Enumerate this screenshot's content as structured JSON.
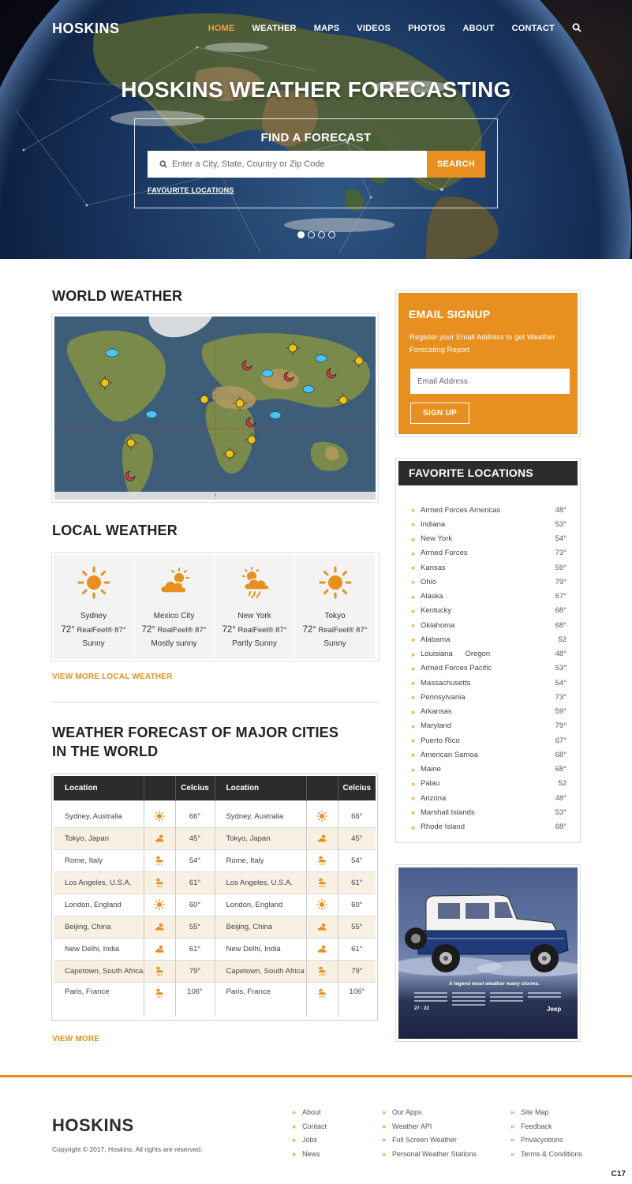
{
  "header": {
    "brand": "HOSKINS",
    "nav": [
      "HOME",
      "WEATHER",
      "MAPS",
      "VIDEOS",
      "PHOTOS",
      "ABOUT",
      "CONTACT"
    ],
    "active_nav": "HOME",
    "title": "HOSKINS WEATHER FORECASTING",
    "search": {
      "heading": "FIND A FORECAST",
      "placeholder": "Enter a City, State, Country or Zip Code",
      "button": "SEARCH",
      "favourites_link": "FAVOURITE LOCATIONS"
    },
    "slider": {
      "count": 4,
      "active": 1
    }
  },
  "world_weather": {
    "title": "WORLD WEATHER"
  },
  "local_weather": {
    "title": "LOCAL WEATHER",
    "cards": [
      {
        "city": "Sydney",
        "temp": "72°",
        "realfeel": "RealFeel® 87°",
        "condition": "Sunny",
        "icon": "sun-icon"
      },
      {
        "city": "Mexico City",
        "temp": "72°",
        "realfeel": "RealFeel® 87°",
        "condition": "Mostly sunny",
        "icon": "cloud-sun-icon"
      },
      {
        "city": "New York",
        "temp": "72°",
        "realfeel": "RealFeel® 87°",
        "condition": "Partly Sunny",
        "icon": "rain-sun-icon"
      },
      {
        "city": "Tokyo",
        "temp": "72°",
        "realfeel": "RealFeel® 87°",
        "condition": "Sunny",
        "icon": "sun-icon"
      }
    ],
    "more_link": "VIEW MORE LOCAL WEATHER"
  },
  "forecast": {
    "title_line1": "WEATHER FORECAST OF MAJOR CITIES",
    "title_line2": "IN THE WORLD",
    "headers": {
      "location": "Location",
      "celcius": "Celcius"
    },
    "rows": [
      {
        "location": "Sydney, Australia",
        "temp": "66°",
        "icon": "sun-icon"
      },
      {
        "location": "Tokyo, Japan",
        "temp": "45°",
        "icon": "cloud-sun-icon"
      },
      {
        "location": "Rome, Italy",
        "temp": "54°",
        "icon": "rain-sun-icon"
      },
      {
        "location": "Los Angeles, U.S.A.",
        "temp": "61°",
        "icon": "rain-sun-icon"
      },
      {
        "location": "London, England",
        "temp": "60°",
        "icon": "sun-icon"
      },
      {
        "location": "Beijing, China",
        "temp": "55°",
        "icon": "cloud-sun-icon"
      },
      {
        "location": "New Delhi, India",
        "temp": "61°",
        "icon": "cloud-sun-icon"
      },
      {
        "location": "Capetown, South Africa",
        "temp": "79°",
        "icon": "rain-sun-icon"
      },
      {
        "location": "Paris, France",
        "temp": "106°",
        "icon": "rain-sun-icon"
      }
    ],
    "more_link": "VIEW MORE"
  },
  "email_signup": {
    "title": "EMAIL SIGNUP",
    "description": "Register your Email Address to get Weather Forecating Report",
    "placeholder": "Email Address",
    "button": "SIGN UP"
  },
  "favorite_locations": {
    "title": "FAVORITE LOCATIONS",
    "items": [
      {
        "name": "Armed Forces Americas",
        "temp": "48°"
      },
      {
        "name": "Indiana",
        "temp": "53°"
      },
      {
        "name": "New York",
        "temp": "54°"
      },
      {
        "name": "Armed Forces",
        "temp": "73°"
      },
      {
        "name": "Kansas",
        "temp": "59°"
      },
      {
        "name": "Ohio",
        "temp": "79°"
      },
      {
        "name": "Alaska",
        "temp": "67°"
      },
      {
        "name": "Kentucky",
        "temp": "68°"
      },
      {
        "name": "Oklahoma",
        "temp": "68°"
      },
      {
        "name": "Alabama",
        "temp": "52"
      },
      {
        "name": "Louisiana      Oregon",
        "temp": "48°"
      },
      {
        "name": "Armed Forces Pacific",
        "temp": "53°"
      },
      {
        "name": "Massachusetts",
        "temp": "54°"
      },
      {
        "name": "Pennsylvania",
        "temp": "73°"
      },
      {
        "name": "Arkansas",
        "temp": "59°"
      },
      {
        "name": "Maryland",
        "temp": "79°"
      },
      {
        "name": "Puerto Rico",
        "temp": "67°"
      },
      {
        "name": "American Samoa",
        "temp": "68°"
      },
      {
        "name": "Maine",
        "temp": "68°"
      },
      {
        "name": "Palau",
        "temp": "52"
      },
      {
        "name": "Arizona",
        "temp": "48°"
      },
      {
        "name": "Marshall Islands",
        "temp": "53°"
      },
      {
        "name": "Rhode Island",
        "temp": "68°"
      }
    ]
  },
  "ad": {
    "headline": "A legend must weather many storms.",
    "brand": "Jeep",
    "numbers": "27 · 22"
  },
  "footer": {
    "brand": "HOSKINS",
    "copyright": "Copyright © 2017, Hoskins. All rights are reserved.",
    "col1": [
      "About",
      "Contact",
      "Jobs",
      "News"
    ],
    "col2": [
      "Our Apps",
      "Weather API",
      "Full Screen Weather",
      "Personal Weather Stations"
    ],
    "col3": [
      "Site Map",
      "Feedback",
      "Privacyotions",
      "Terms & Conditions"
    ],
    "corner": "C17"
  },
  "colors": {
    "accent": "#e8901f",
    "dark": "#2c2c2c",
    "row_alt": "#f9f0e4"
  }
}
